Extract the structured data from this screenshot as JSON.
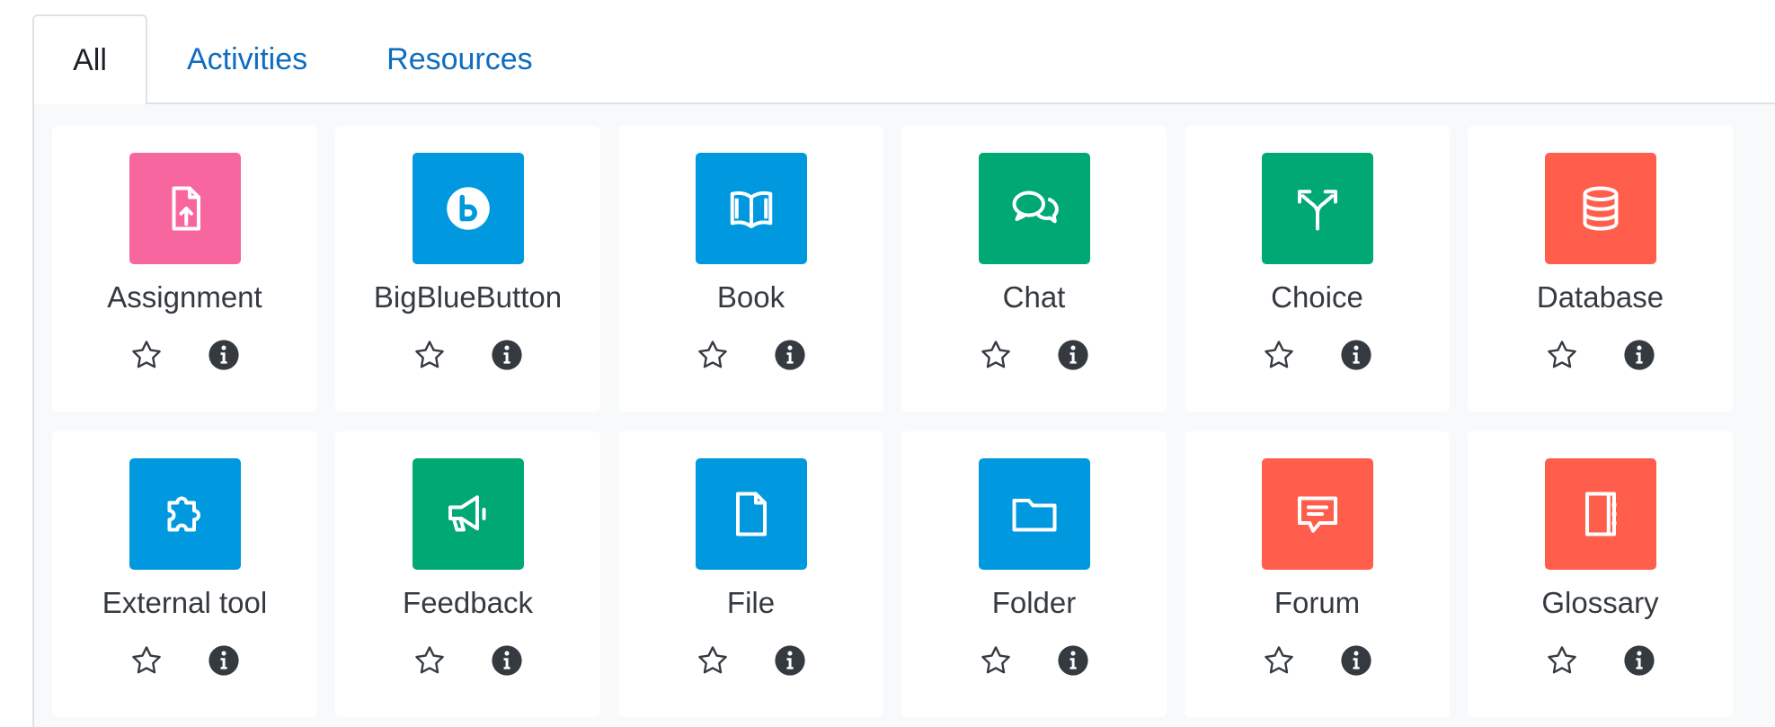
{
  "tabs": [
    {
      "label": "All",
      "active": true
    },
    {
      "label": "Activities",
      "active": false
    },
    {
      "label": "Resources",
      "active": false
    }
  ],
  "colors": {
    "pink": "#f7669f",
    "blue": "#0099df",
    "green": "#00a873",
    "red": "#ff5e4d",
    "link": "#0f6cbf"
  },
  "modules": [
    {
      "label": "Assignment",
      "icon": "assignment-icon",
      "color": "#f7669f"
    },
    {
      "label": "BigBlueButton",
      "icon": "bigbluebutton-icon",
      "color": "#0099df"
    },
    {
      "label": "Book",
      "icon": "book-icon",
      "color": "#0099df"
    },
    {
      "label": "Chat",
      "icon": "chat-icon",
      "color": "#00a873"
    },
    {
      "label": "Choice",
      "icon": "choice-icon",
      "color": "#00a873"
    },
    {
      "label": "Database",
      "icon": "database-icon",
      "color": "#ff5e4d"
    },
    {
      "label": "External tool",
      "icon": "external-tool-icon",
      "color": "#0099df"
    },
    {
      "label": "Feedback",
      "icon": "feedback-icon",
      "color": "#00a873"
    },
    {
      "label": "File",
      "icon": "file-icon",
      "color": "#0099df"
    },
    {
      "label": "Folder",
      "icon": "folder-icon",
      "color": "#0099df"
    },
    {
      "label": "Forum",
      "icon": "forum-icon",
      "color": "#ff5e4d"
    },
    {
      "label": "Glossary",
      "icon": "glossary-icon",
      "color": "#ff5e4d"
    }
  ]
}
